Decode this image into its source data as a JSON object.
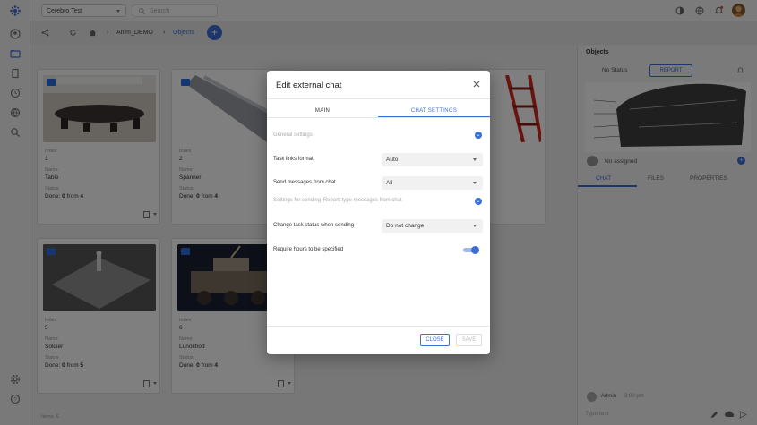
{
  "topbar": {
    "project": "Cerebro Test",
    "search_placeholder": "Search"
  },
  "breadcrumb": {
    "path_project": "Anim_DEMO",
    "path_current": "Objects"
  },
  "cards": [
    {
      "index_label": "Index",
      "index": "1",
      "name_label": "Name",
      "name": "Table",
      "status_label": "Status",
      "done_prefix": "Done:",
      "done_value": "0",
      "done_from": "from",
      "done_total": "4"
    },
    {
      "index_label": "Index",
      "index": "2",
      "name_label": "Name",
      "name": "Spanner",
      "status_label": "Status",
      "done_prefix": "Done:",
      "done_value": "0",
      "done_from": "from",
      "done_total": "4"
    },
    {
      "index_label": "Index",
      "index": "5",
      "name_label": "Name",
      "name": "Soldier",
      "status_label": "Status",
      "done_prefix": "Done:",
      "done_value": "0",
      "done_from": "from",
      "done_total": "5"
    },
    {
      "index_label": "Index",
      "index": "6",
      "name_label": "Name",
      "name": "Lunokhod",
      "status_label": "Status",
      "done_prefix": "Done:",
      "done_value": "0",
      "done_from": "from",
      "done_total": "4"
    }
  ],
  "right_panel": {
    "title": "Objects",
    "status": "No Status",
    "report": "REPORT",
    "assigned": "No assigned",
    "tabs": [
      "CHAT",
      "FILES",
      "PROPERTIES"
    ],
    "chat_user": "Admin",
    "chat_time": "3:00 pm",
    "message_placeholder": "Type text"
  },
  "footer": {
    "items_text": "Items: 6"
  },
  "modal": {
    "title": "Edit external chat",
    "tab_main": "MAIN",
    "tab_chat_settings": "CHAT SETTINGS",
    "general_settings": "General settings",
    "task_links_format_label": "Task links format",
    "task_links_format_value": "Auto",
    "send_messages_label": "Send messages from chat",
    "send_messages_value": "All",
    "report_settings": "Settings for sending 'Report' type messages from chat",
    "change_status_label": "Change task status when sending",
    "change_status_value": "Do not change",
    "require_hours_label": "Require hours to be specified",
    "require_hours_enabled": true,
    "close_button": "CLOSE",
    "save_button": "SAVE"
  },
  "colors": {
    "accent": "#3b6fd6",
    "overlay": "rgba(0,0,0,0.5)"
  }
}
